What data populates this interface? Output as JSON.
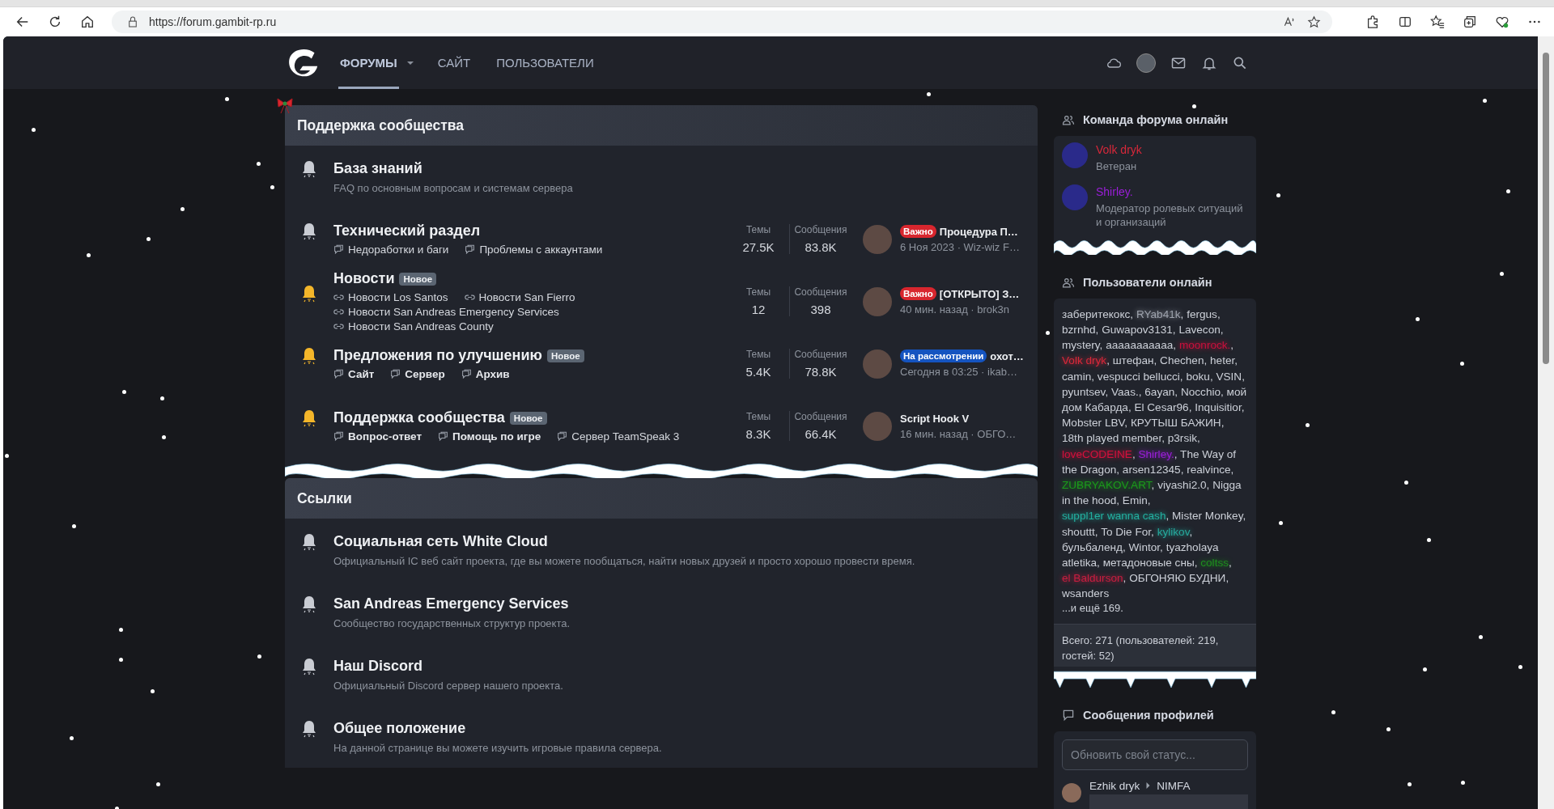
{
  "browser": {
    "url": "https://forum.gambit-rp.ru"
  },
  "nav": {
    "tabs": [
      {
        "label": "ФОРУМЫ",
        "selected": true,
        "has_menu": true
      },
      {
        "label": "САЙТ",
        "selected": false,
        "has_menu": false
      },
      {
        "label": "ПОЛЬЗОВАТЕЛИ",
        "selected": false,
        "has_menu": false
      }
    ]
  },
  "categories": [
    {
      "title": "Поддержка сообщества",
      "decorated": true,
      "nodes": [
        {
          "title": "База знаний",
          "unread": false,
          "description": "FAQ по основным вопросам и системам сервера"
        },
        {
          "title": "Технический раздел",
          "unread": false,
          "subforums": [
            {
              "label": "Недоработки и баги",
              "kind": "forum",
              "unread": false
            },
            {
              "label": "Проблемы с аккаунтами",
              "kind": "forum",
              "unread": false
            }
          ],
          "stats": [
            {
              "label": "Темы",
              "value": "27.5K"
            },
            {
              "label": "Сообщения",
              "value": "83.8K"
            }
          ],
          "last_post": {
            "prefix": {
              "label": "Важно",
              "color": "#d8262e"
            },
            "title": "Процедура П…",
            "meta": "6 Ноя 2023 · Wiz-wiz F…"
          }
        },
        {
          "title": "Новости",
          "unread": true,
          "badge": "Новое",
          "subforums": [
            {
              "label": "Новости Los Santos",
              "kind": "link",
              "unread": false
            },
            {
              "label": "Новости San Fierro",
              "kind": "link",
              "unread": false
            },
            {
              "label": "Новости San Andreas Emergency Services",
              "kind": "link",
              "unread": false
            },
            {
              "label": "Новости San Andreas County",
              "kind": "link",
              "unread": false
            }
          ],
          "stats": [
            {
              "label": "Темы",
              "value": "12"
            },
            {
              "label": "Сообщения",
              "value": "398"
            }
          ],
          "last_post": {
            "prefix": {
              "label": "Важно",
              "color": "#d8262e"
            },
            "title": "[ОТКРЫТО] З…",
            "meta": "40 мин. назад · brok3n"
          }
        },
        {
          "title": "Предложения по улучшению",
          "unread": true,
          "badge": "Новое",
          "subforums": [
            {
              "label": "Сайт",
              "kind": "forum",
              "unread": true
            },
            {
              "label": "Сервер",
              "kind": "forum",
              "unread": true
            },
            {
              "label": "Архив",
              "kind": "forum",
              "unread": true
            }
          ],
          "stats": [
            {
              "label": "Темы",
              "value": "5.4K"
            },
            {
              "label": "Сообщения",
              "value": "78.8K"
            }
          ],
          "last_post": {
            "prefix": {
              "label": "На рассмотрении",
              "color": "#1554c0"
            },
            "title": "охот…",
            "meta": "Сегодня в 03:25 · ikab…"
          }
        },
        {
          "title": "Поддержка сообщества",
          "unread": true,
          "badge": "Новое",
          "subforums": [
            {
              "label": "Вопрос-ответ",
              "kind": "forum",
              "unread": true
            },
            {
              "label": "Помощь по игре",
              "kind": "forum",
              "unread": true
            },
            {
              "label": "Сервер TeamSpeak 3",
              "kind": "forum",
              "unread": false
            }
          ],
          "stats": [
            {
              "label": "Темы",
              "value": "8.3K"
            },
            {
              "label": "Сообщения",
              "value": "66.4K"
            }
          ],
          "last_post": {
            "title": "Script Hook V",
            "meta": "16 мин. назад · ОБГО…"
          }
        }
      ]
    },
    {
      "title": "Ссылки",
      "decorated": false,
      "nodes": [
        {
          "title": "Социальная сеть White Cloud",
          "unread": false,
          "description": "Официальный IC веб сайт проекта, где вы можете пообщаться, найти новых друзей и просто хорошо провести время."
        },
        {
          "title": "San Andreas Emergency Services",
          "unread": false,
          "description": "Сообщество государственных структур проекта."
        },
        {
          "title": "Наш Discord",
          "unread": false,
          "description": "Официальный Discord сервер нашего проекта."
        },
        {
          "title": "Общее положение",
          "unread": false,
          "description": "На данной странице вы можете изучить игровые правила сервера."
        }
      ]
    }
  ],
  "sidebar": {
    "staff": {
      "title": "Команда форума онлайн",
      "members": [
        {
          "name": "Volk dryk",
          "color": "#d8283a",
          "role": "Ветеран"
        },
        {
          "name": "Shirley.",
          "color": "#9a1ed8",
          "role": "Модератор ролевых ситуаций и организаций"
        }
      ]
    },
    "online": {
      "title": "Пользователи онлайн",
      "separator": ", ",
      "users": [
        {
          "name": "заберитекокс"
        },
        {
          "name": "RYab41k",
          "color": "#9ea3ad"
        },
        {
          "name": "fergus"
        },
        {
          "name": "bzrnhd"
        },
        {
          "name": "Guwapov3131"
        },
        {
          "name": "Lavecon"
        },
        {
          "name": "mystery"
        },
        {
          "name": "ааааааааааа"
        },
        {
          "name": "moonrock.",
          "color": "#c8103c"
        },
        {
          "name": "Volk dryk",
          "color": "#d8283a"
        },
        {
          "name": "штефан"
        },
        {
          "name": "Chechen"
        },
        {
          "name": "heter"
        },
        {
          "name": "camin"
        },
        {
          "name": "vespucci bellucci"
        },
        {
          "name": "boku"
        },
        {
          "name": "VSIN"
        },
        {
          "name": "pyuntsev"
        },
        {
          "name": "Vaas."
        },
        {
          "name": "6ayan"
        },
        {
          "name": "Nocchio"
        },
        {
          "name": "мой дом Кабарда"
        },
        {
          "name": "El Cesar96"
        },
        {
          "name": "Inquisitior"
        },
        {
          "name": "Mobster LBV"
        },
        {
          "name": "КРУТЫШ БАЖИН"
        },
        {
          "name": "18th played member"
        },
        {
          "name": "p3rsik"
        },
        {
          "name": "loveCODEINE",
          "color": "#d3103c"
        },
        {
          "name": "Shirley.",
          "color": "#9a1ed8"
        },
        {
          "name": "The Way of the Dragon"
        },
        {
          "name": "arsen12345"
        },
        {
          "name": "realvince"
        },
        {
          "name": "ZUBRYAKOV.ART",
          "color": "#1b9a1b"
        },
        {
          "name": "viyashi2.0"
        },
        {
          "name": "Nigga in the hood"
        },
        {
          "name": "Emin"
        },
        {
          "name": "suppl1er wanna cash",
          "color": "#22b0a0"
        },
        {
          "name": "Mister Monkey"
        },
        {
          "name": "shouttt"
        },
        {
          "name": "To Die For"
        },
        {
          "name": "kylikov",
          "color": "#26a89c"
        },
        {
          "name": "бульбаленд"
        },
        {
          "name": "Wintor"
        },
        {
          "name": "tyazholaya atletika"
        },
        {
          "name": "метадоновые сны"
        },
        {
          "name": "coltss",
          "color": "#1e8e1e"
        },
        {
          "name": "el Baldurson",
          "color": "#c81e40"
        },
        {
          "name": "ОБГОНЯЮ БУДНИ"
        },
        {
          "name": "wsanders"
        }
      ],
      "more": "...и ещё 169.",
      "total": "Всего: 271 (пользователей: 219, гостей: 52)"
    },
    "profile_posts": {
      "title": "Сообщения профилей",
      "placeholder": "Обновить свой статус...",
      "posts": [
        {
          "author": "Ezhik dryk",
          "target": "NIMFA"
        }
      ]
    }
  }
}
